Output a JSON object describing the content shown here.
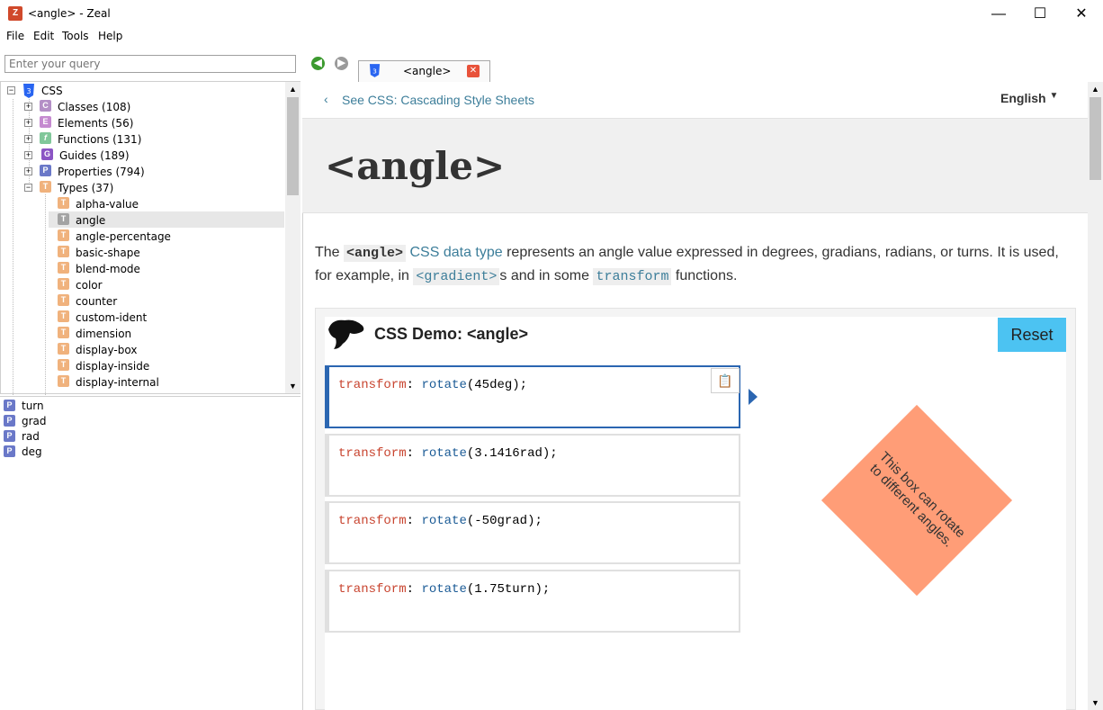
{
  "window": {
    "title": "<angle> - Zeal",
    "app_icon": "Z",
    "controls": {
      "minimize": "—",
      "maximize": "☐",
      "close": "✕"
    }
  },
  "menu": [
    "File",
    "Edit",
    "Tools",
    "Help"
  ],
  "search": {
    "value": "",
    "placeholder": "Enter your query"
  },
  "tree": {
    "root": "CSS",
    "groups": [
      {
        "label": "Classes (108)",
        "badge": "C",
        "color": "#b48fc6"
      },
      {
        "label": "Elements (56)",
        "badge": "E",
        "color": "#c58ad0"
      },
      {
        "label": "Functions (131)",
        "badge": "f",
        "color": "#80c79a"
      },
      {
        "label": "Guides (189)",
        "badge": "G",
        "color": "#8b55c4"
      },
      {
        "label": "Properties (794)",
        "badge": "P",
        "color": "#6a78c8"
      },
      {
        "label": "Types (37)",
        "badge": "T",
        "color": "#f0b27d"
      }
    ],
    "types": [
      "alpha-value",
      "angle",
      "angle-percentage",
      "basic-shape",
      "blend-mode",
      "color",
      "counter",
      "custom-ident",
      "dimension",
      "display-box",
      "display-inside",
      "display-internal"
    ],
    "selected": "angle"
  },
  "results": [
    {
      "label": "turn",
      "badge": "P"
    },
    {
      "label": "grad",
      "badge": "P"
    },
    {
      "label": "rad",
      "badge": "P"
    },
    {
      "label": "deg",
      "badge": "P"
    }
  ],
  "tab": {
    "label": "<angle>",
    "icon": "css3-icon"
  },
  "content": {
    "breadcrumb": "See CSS: Cascading Style Sheets",
    "language": "English",
    "title": "<angle>",
    "intro": {
      "p1": "The ",
      "code1": "<angle>",
      "link1": "CSS data type",
      "p2": " represents an angle value expressed in degrees, gradians, radians, or turns. It is used, for example, in ",
      "code2": "<gradient>",
      "p3": "s and in some ",
      "code3": "transform",
      "p4": " functions."
    },
    "demo": {
      "title": "CSS Demo: <angle>",
      "reset": "Reset",
      "examples": [
        {
          "prop": "transform",
          "fn": "rotate",
          "arg": "(45deg);"
        },
        {
          "prop": "transform",
          "fn": "rotate",
          "arg": "(3.1416rad);"
        },
        {
          "prop": "transform",
          "fn": "rotate",
          "arg": "(-50grad);"
        },
        {
          "prop": "transform",
          "fn": "rotate",
          "arg": "(1.75turn);"
        }
      ],
      "box_text": "This box can rotate to different angles.",
      "box_color": "#ff9d77",
      "rotation_deg": 45
    }
  }
}
